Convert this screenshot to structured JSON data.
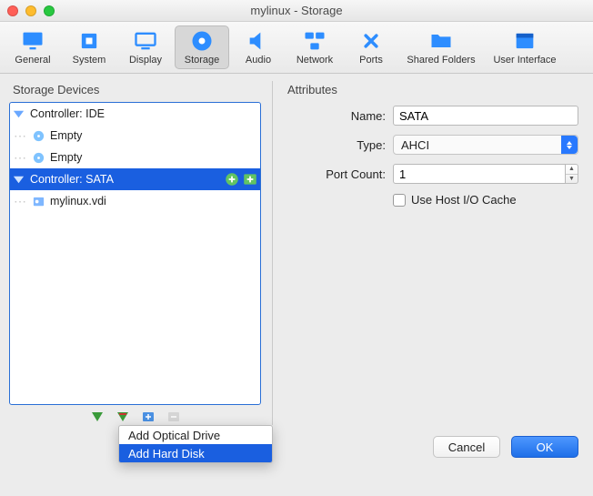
{
  "window": {
    "title": "mylinux - Storage"
  },
  "toolbar": {
    "items": [
      {
        "id": "general",
        "label": "General"
      },
      {
        "id": "system",
        "label": "System"
      },
      {
        "id": "display",
        "label": "Display"
      },
      {
        "id": "storage",
        "label": "Storage",
        "selected": true
      },
      {
        "id": "audio",
        "label": "Audio"
      },
      {
        "id": "network",
        "label": "Network"
      },
      {
        "id": "ports",
        "label": "Ports"
      },
      {
        "id": "shared",
        "label": "Shared Folders"
      },
      {
        "id": "ui",
        "label": "User Interface"
      }
    ]
  },
  "left": {
    "title": "Storage Devices",
    "tree": [
      {
        "kind": "controller",
        "label": "Controller: IDE",
        "selected": false
      },
      {
        "kind": "leaf",
        "label": "Empty",
        "icon": "disc"
      },
      {
        "kind": "leaf",
        "label": "Empty",
        "icon": "disc"
      },
      {
        "kind": "controller",
        "label": "Controller: SATA",
        "selected": true
      },
      {
        "kind": "leaf",
        "label": "mylinux.vdi",
        "icon": "hdd"
      }
    ],
    "menu": {
      "items": [
        {
          "label": "Add Optical Drive",
          "selected": false
        },
        {
          "label": "Add Hard Disk",
          "selected": true
        }
      ]
    }
  },
  "right": {
    "title": "Attributes",
    "name_label": "Name:",
    "name_value": "SATA",
    "type_label": "Type:",
    "type_value": "AHCI",
    "portcount_label": "Port Count:",
    "portcount_value": "1",
    "hostio_label": "Use Host I/O Cache",
    "hostio_checked": false
  },
  "footer": {
    "cancel": "Cancel",
    "ok": "OK"
  }
}
